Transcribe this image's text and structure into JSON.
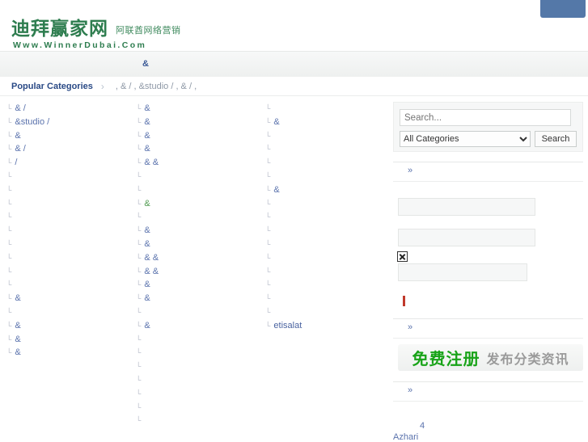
{
  "window": {
    "top_tab_color": "#5478a8"
  },
  "header": {
    "logo_cn": "迪拜赢家网",
    "logo_sub_cn": "阿联酋网络营销",
    "logo_url": "Www.WinnerDubai.Com",
    "logo_color": "#2e7d4f"
  },
  "nav": {
    "item_label": "&"
  },
  "breadcrumb": {
    "title": "Popular Categories",
    "arrow": "›",
    "items": [
      {
        "sep": ",",
        "label": "&"
      },
      {
        "sep": "/",
        "label": ","
      },
      {
        "sep": "",
        "label": "&studio"
      },
      {
        "sep": "/",
        "label": ","
      },
      {
        "sep": "",
        "label": "&"
      },
      {
        "sep": "/",
        "label": ","
      }
    ],
    "raw": ",  &   /  ,   &studio /  ,   &   /  ,"
  },
  "main": {
    "marker": "└",
    "columns": [
      {
        "name": "column-1",
        "items": [
          {
            "text": "&   /",
            "style": ""
          },
          {
            "text": "&studio  /",
            "style": ""
          },
          {
            "text": "&",
            "style": ""
          },
          {
            "text": "&    /",
            "style": ""
          },
          {
            "text": "/",
            "style": ""
          },
          {
            "text": "",
            "style": ""
          },
          {
            "text": "",
            "style": ""
          },
          {
            "text": "",
            "style": "blank"
          },
          {
            "text": "",
            "style": "blank"
          },
          {
            "text": "",
            "style": "blank"
          },
          {
            "text": "",
            "style": ""
          },
          {
            "text": "",
            "style": ""
          },
          {
            "text": "",
            "style": "blank"
          },
          {
            "text": "",
            "style": "blank"
          },
          {
            "text": "&",
            "style": ""
          },
          {
            "text": "",
            "style": ""
          },
          {
            "text": "&",
            "style": ""
          },
          {
            "text": "&",
            "style": ""
          },
          {
            "text": "&",
            "style": ""
          }
        ]
      },
      {
        "name": "column-2",
        "items": [
          {
            "text": "&",
            "style": ""
          },
          {
            "text": "&",
            "style": ""
          },
          {
            "text": "&",
            "style": ""
          },
          {
            "text": "&",
            "style": ""
          },
          {
            "text": "&   &",
            "style": ""
          },
          {
            "text": "",
            "style": ""
          },
          {
            "text": "",
            "style": "blank"
          },
          {
            "text": "&",
            "style": "green"
          },
          {
            "text": "",
            "style": ""
          },
          {
            "text": "&",
            "style": ""
          },
          {
            "text": "&",
            "style": ""
          },
          {
            "text": "&  &",
            "style": ""
          },
          {
            "text": "&   &",
            "style": ""
          },
          {
            "text": "&",
            "style": ""
          },
          {
            "text": "&",
            "style": ""
          },
          {
            "text": "",
            "style": ""
          },
          {
            "text": "&",
            "style": ""
          },
          {
            "text": "",
            "style": ""
          },
          {
            "text": "",
            "style": ""
          },
          {
            "text": "",
            "style": ""
          },
          {
            "text": "",
            "style": ""
          },
          {
            "text": "",
            "style": ""
          },
          {
            "text": "",
            "style": ""
          },
          {
            "text": "",
            "style": ""
          }
        ]
      },
      {
        "name": "column-3",
        "items": [
          {
            "text": "",
            "style": ""
          },
          {
            "text": "&",
            "style": ""
          },
          {
            "text": "",
            "style": ""
          },
          {
            "text": "",
            "style": ""
          },
          {
            "text": "",
            "style": ""
          },
          {
            "text": "",
            "style": ""
          },
          {
            "text": "&",
            "style": ""
          },
          {
            "text": "",
            "style": ""
          },
          {
            "text": "",
            "style": ""
          },
          {
            "text": "",
            "style": "blank"
          },
          {
            "text": "",
            "style": "blank"
          },
          {
            "text": "",
            "style": ""
          },
          {
            "text": "",
            "style": ""
          },
          {
            "text": "",
            "style": ""
          },
          {
            "text": "",
            "style": ""
          },
          {
            "text": "",
            "style": ""
          },
          {
            "text": "etisalat",
            "style": "dark"
          }
        ]
      }
    ]
  },
  "sidebar": {
    "search": {
      "placeholder": "Search...",
      "value": "",
      "category_selected": "All Categories",
      "category_options": [
        "All Categories"
      ],
      "button_label": "Search"
    },
    "section_more": "»",
    "promo": {
      "green_text": "免费注册",
      "gray_text": "发布分类资讯",
      "green_color": "#18a318",
      "gray_color": "#9a9a9a"
    },
    "tail": {
      "number": "4",
      "name": "Azhari"
    },
    "icons": {
      "broken_image": "broken-image-icon",
      "red_marker": "|"
    }
  }
}
